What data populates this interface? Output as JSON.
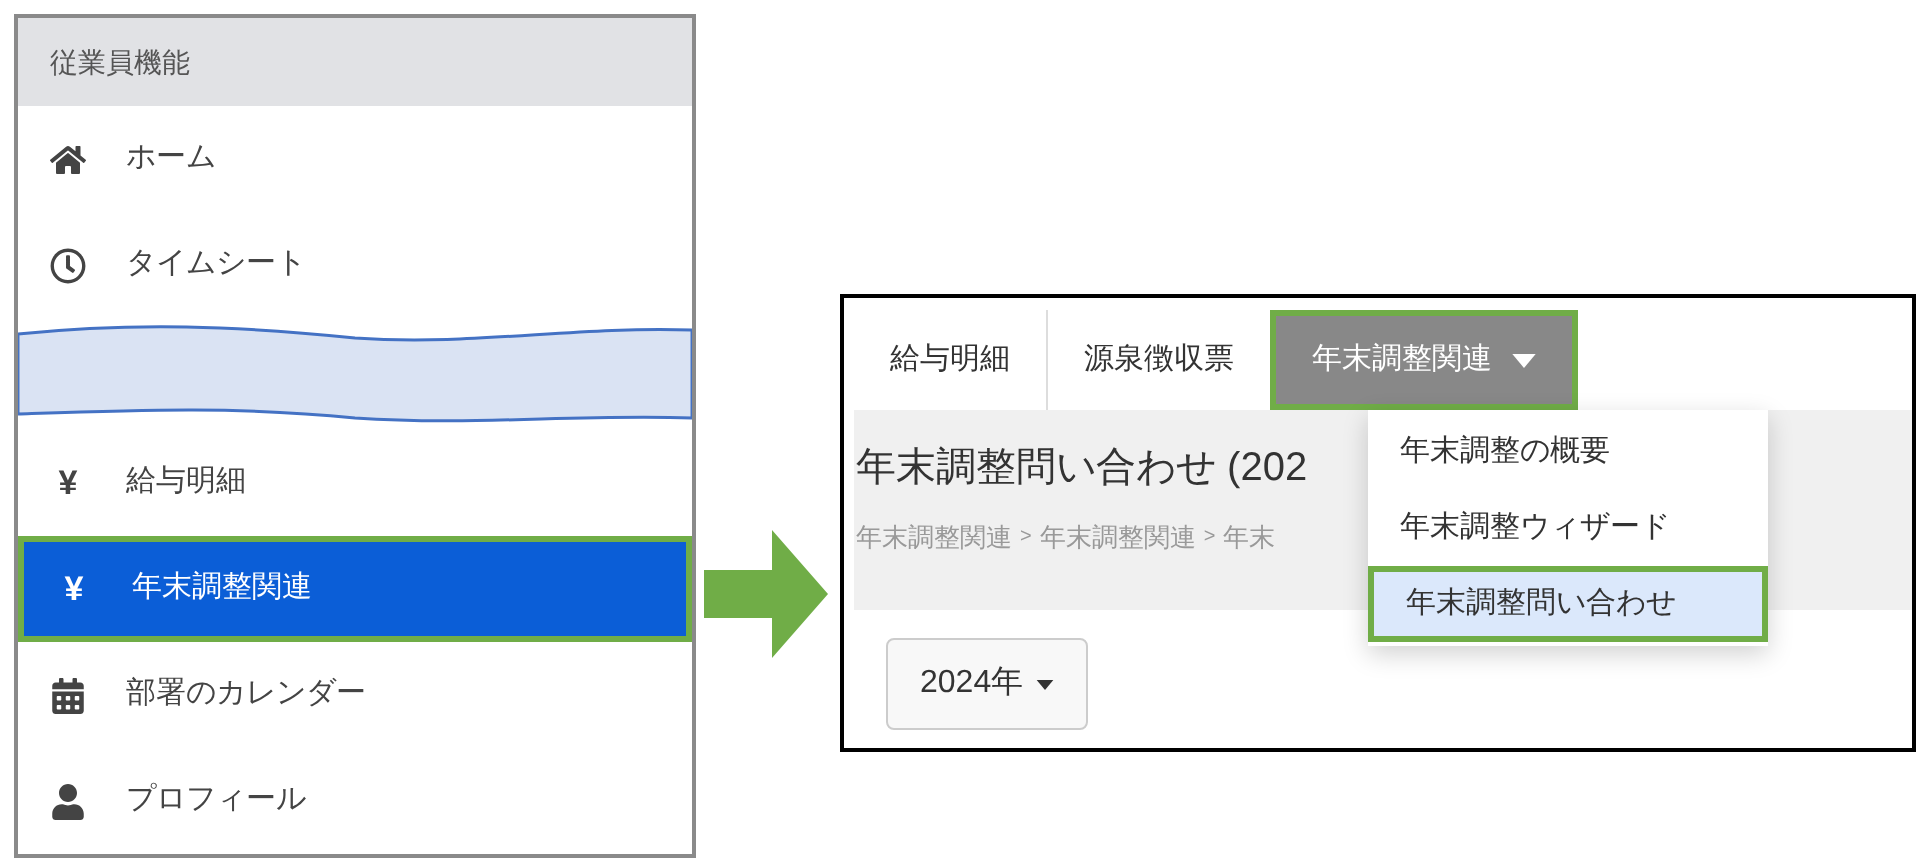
{
  "sidebar": {
    "title": "従業員機能",
    "items": [
      {
        "kind": "item",
        "label": "ホーム",
        "selected": false,
        "highlighted": false
      },
      {
        "kind": "item",
        "label": "タイムシート",
        "selected": false,
        "highlighted": false
      },
      {
        "kind": "break"
      },
      {
        "kind": "item",
        "glyph": "¥",
        "label": "給与明細",
        "selected": false,
        "highlighted": false
      },
      {
        "kind": "item",
        "glyph": "¥",
        "label": "年末調整関連",
        "selected": true,
        "highlighted": true
      },
      {
        "kind": "item",
        "label": "部署のカレンダー",
        "selected": false,
        "highlighted": false
      },
      {
        "kind": "item",
        "label": "プロフィール",
        "selected": false,
        "highlighted": false
      }
    ]
  },
  "page": {
    "tabs": [
      {
        "label": "給与明細",
        "selected": false,
        "highlighted": false,
        "dropdown": false
      },
      {
        "label": "源泉徴収票",
        "selected": false,
        "highlighted": false,
        "dropdown": false
      },
      {
        "label": "年末調整関連",
        "selected": true,
        "highlighted": true,
        "dropdown": true
      }
    ],
    "title": "年末調整問い合わせ (202",
    "breadcrumb": [
      "年末調整関連",
      "年末調整関連",
      "年末"
    ],
    "breadcrumb_separator": ">",
    "year_button": "2024年",
    "menu": [
      {
        "label": "年末調整の概要",
        "selected": false,
        "highlighted": false
      },
      {
        "label": "年末調整ウィザード",
        "selected": false,
        "highlighted": false
      },
      {
        "label": "年末調整問い合わせ",
        "selected": true,
        "highlighted": true
      }
    ]
  }
}
